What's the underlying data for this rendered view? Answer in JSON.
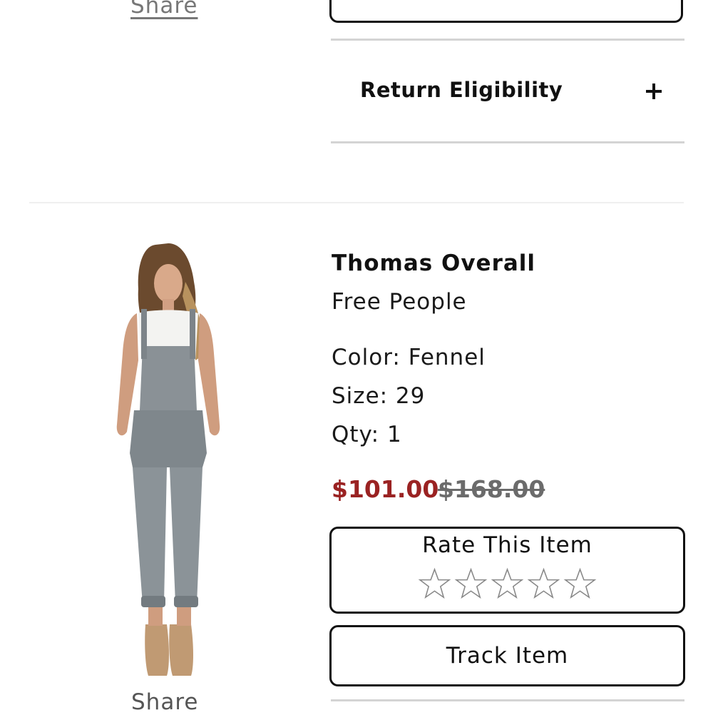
{
  "top_section": {
    "share_label": "Share",
    "track_label": "Track Item",
    "return_label": "Return Eligibility"
  },
  "item": {
    "name": "Thomas Overall",
    "brand": "Free People",
    "color": "Color: Fennel",
    "size": "Size: 29",
    "qty": "Qty: 1",
    "sale_price": "$101.00",
    "original_price": "$168.00",
    "rate_label": "Rate This Item",
    "rating": 0,
    "rating_max": 5,
    "track_label": "Track Item",
    "share_label": "Share"
  },
  "colors": {
    "sale_price": "#9a2222",
    "original_price": "#6b6b6b",
    "border": "#111111"
  }
}
